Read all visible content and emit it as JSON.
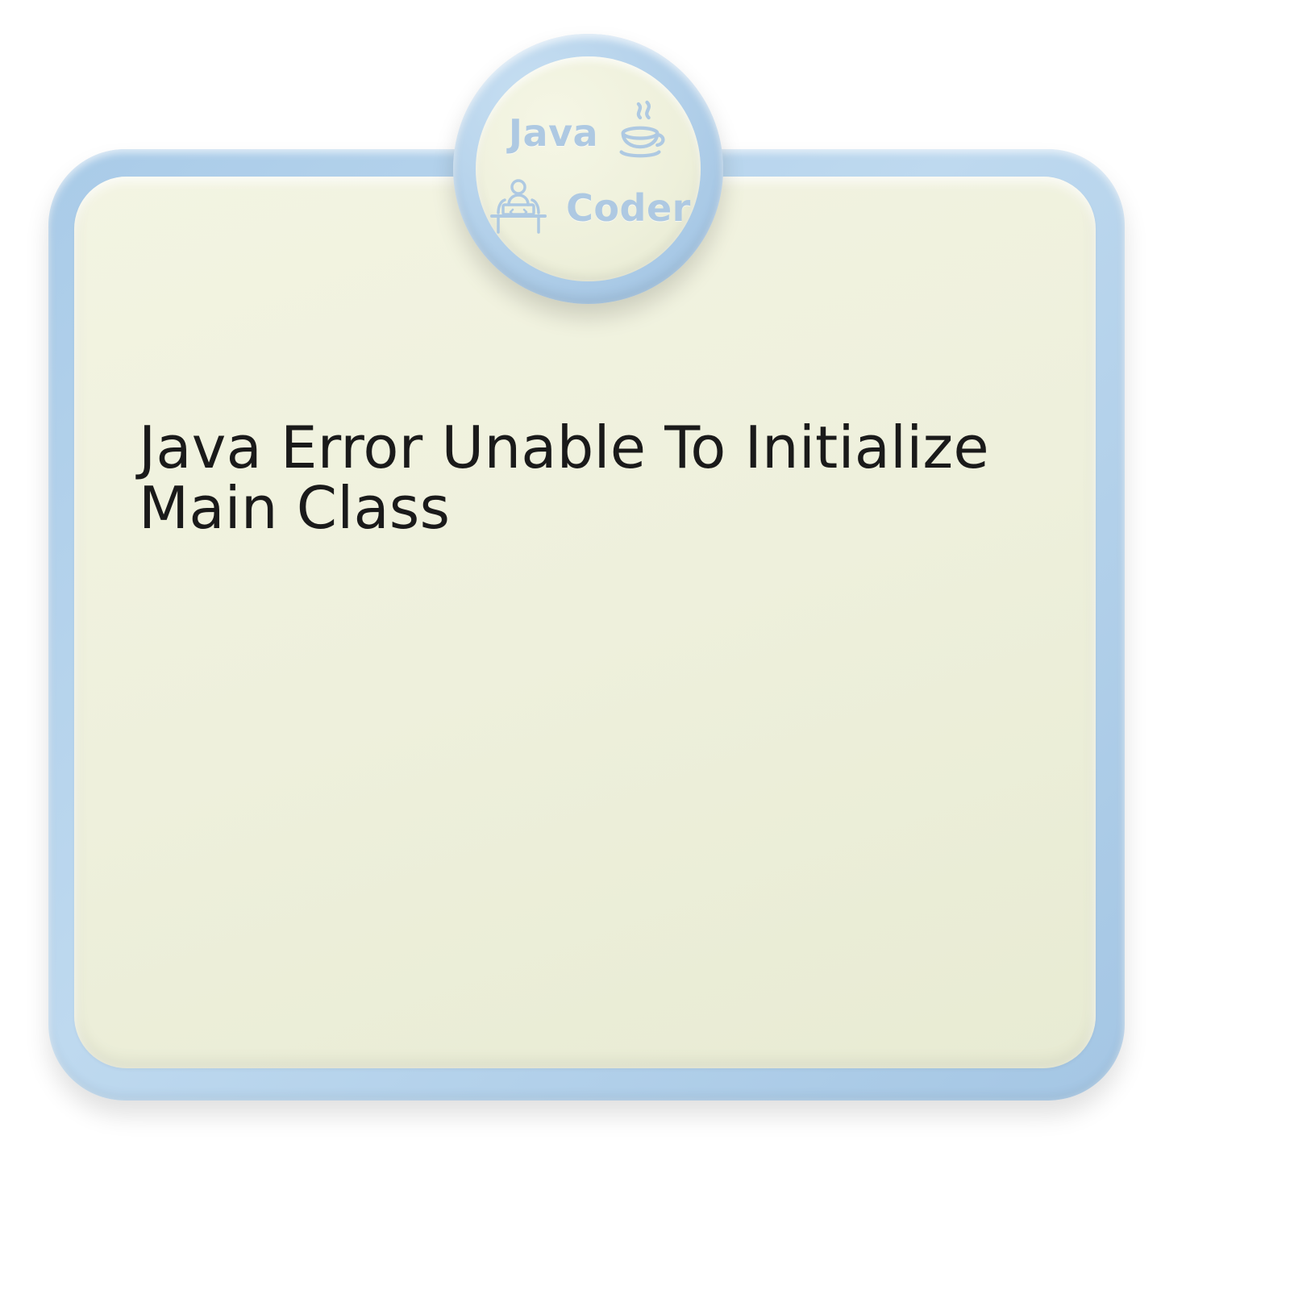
{
  "badge": {
    "word_top": "Java",
    "word_bottom": "Coder",
    "icon_java": "java-cup-icon",
    "icon_coder": "developer-at-desk-icon"
  },
  "headline": {
    "text": "Java Error Unable To Initialize Main Class"
  },
  "colors": {
    "frame": "#aecde7",
    "panel": "#eef0dc",
    "badge_accent": "#aec9e2",
    "text": "#1a1a1a"
  }
}
